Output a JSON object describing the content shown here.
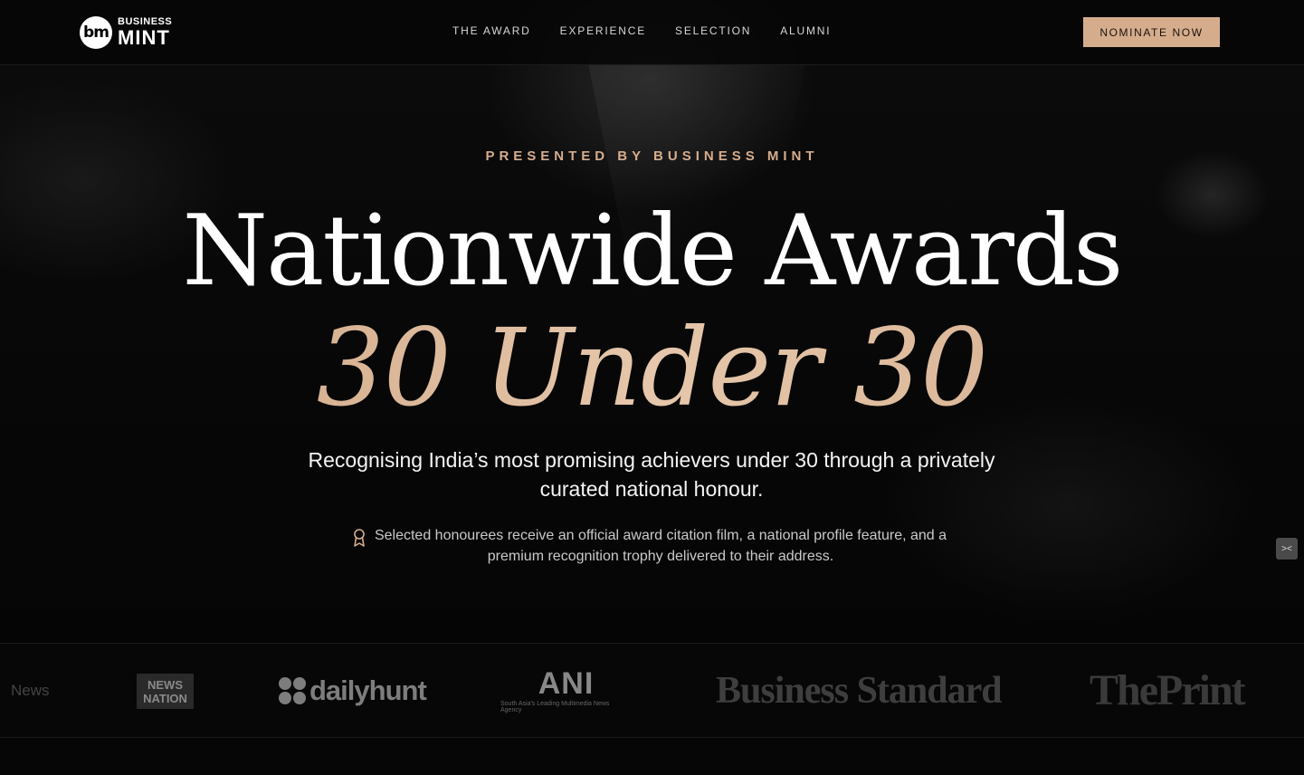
{
  "brand": {
    "logo_mark": "bm",
    "logo_top": "BUSINESS",
    "logo_bottom": "MINT"
  },
  "nav": {
    "items": [
      "THE AWARD",
      "EXPERIENCE",
      "SELECTION",
      "ALUMNI"
    ]
  },
  "cta": {
    "label": "NOMINATE NOW"
  },
  "hero": {
    "eyebrow": "PRESENTED BY BUSINESS MINT",
    "title": "Nationwide Awards",
    "title_accent": "30 Under 30",
    "subtitle": "Recognising India’s most promising achievers under 30 through a privately curated national honour.",
    "note": "Selected honourees receive an official award citation film, a national profile feature, and a premium recognition trophy delivered to their address."
  },
  "press": {
    "items": [
      {
        "name": "News"
      },
      {
        "name_line1": "NEWS",
        "name_line2": "NATION"
      },
      {
        "name": "dailyhunt"
      },
      {
        "name": "ANI",
        "tagline": "South Asia's Leading Multimedia News Agency"
      },
      {
        "name": "Business Standard"
      },
      {
        "name": "ThePrint"
      }
    ]
  },
  "colors": {
    "accent": "#d6ad8c",
    "background": "#060606"
  },
  "icons": {
    "award": "award-ribbon-icon",
    "side": "collapse-icon"
  }
}
